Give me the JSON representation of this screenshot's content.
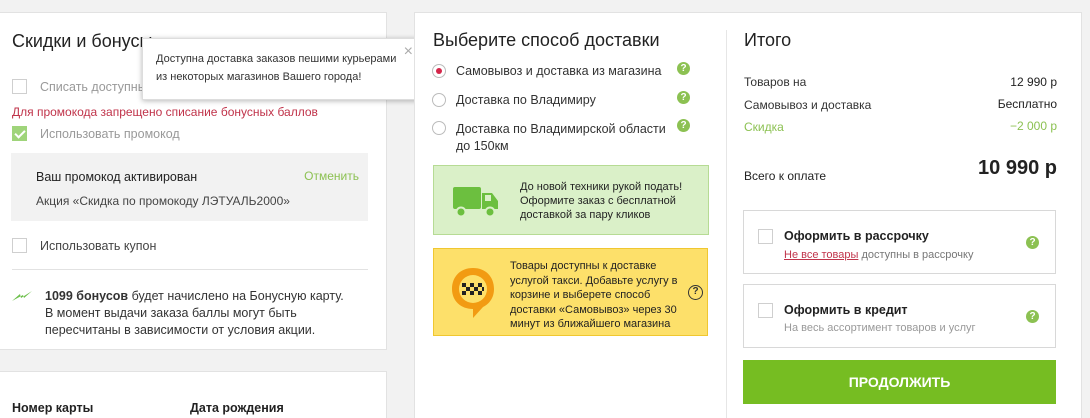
{
  "discounts": {
    "title": "Скидки и бонусы",
    "write_off_label": "Списать доступные",
    "promo_error": "Для промокода запрещено списание бонусных баллов",
    "use_promo_label": "Использовать промокод",
    "promo_box_title": "Ваш промокод активирован",
    "promo_cancel": "Отменить",
    "promo_box_desc": "Акция «Скидка по промокоду ЛЭТУАЛЬ2000»",
    "use_coupon_label": "Использовать купон",
    "bonus_strong": "1099 бонусов",
    "bonus_rest": " будет начислено на Бонусную карту.",
    "bonus_line2": "В момент выдачи заказа баллы могут быть",
    "bonus_line3": "пересчитаны в зависимости от условия акции."
  },
  "card_section": {
    "card_number_label": "Номер карты",
    "birth_date_label": "Дата рождения"
  },
  "tooltip": {
    "line1": "Доступна доставка заказов пешими курьерами",
    "line2": "из некоторых магазинов Вашего города!"
  },
  "delivery": {
    "title": "Выберите способ доставки",
    "options": [
      {
        "line1": "Самовывоз и доставка из магазина",
        "line2": ""
      },
      {
        "line1": "Доставка по Владимиру",
        "line2": ""
      },
      {
        "line1": "Доставка по Владимирской области",
        "line2": "до 150км"
      }
    ],
    "green_promo": [
      "До новой техники рукой подать!",
      "Оформите заказ с бесплатной",
      "доставкой за пару кликов"
    ],
    "yellow_promo": [
      "Товары доступны к доставке",
      "услугой такси. Добавьте услугу в",
      "корзине и выберете способ",
      "доставки «Самовывоз» через 30",
      "минут из ближайшего магазина"
    ]
  },
  "summary": {
    "title": "Итого",
    "goods_label": "Товаров на",
    "goods_value": "12 990 р",
    "pickup_label": "Самовывоз и доставка",
    "pickup_value": "Бесплатно",
    "discount_label": "Скидка",
    "discount_value": "−2 000 р",
    "total_label": "Всего к оплате",
    "total_value": "10 990 р",
    "installment_title": "Оформить в рассрочку",
    "installment_link": "Не все товары",
    "installment_rest": " доступны в рассрочку",
    "credit_title": "Оформить в кредит",
    "credit_desc": "На весь ассортимент товаров и услуг",
    "continue_button": "ПРОДОЛЖИТЬ"
  },
  "colors": {
    "accent_green": "#8cc152",
    "button_green": "#76bd22",
    "error_red": "#c0334a",
    "radio_red": "#d4264a"
  }
}
